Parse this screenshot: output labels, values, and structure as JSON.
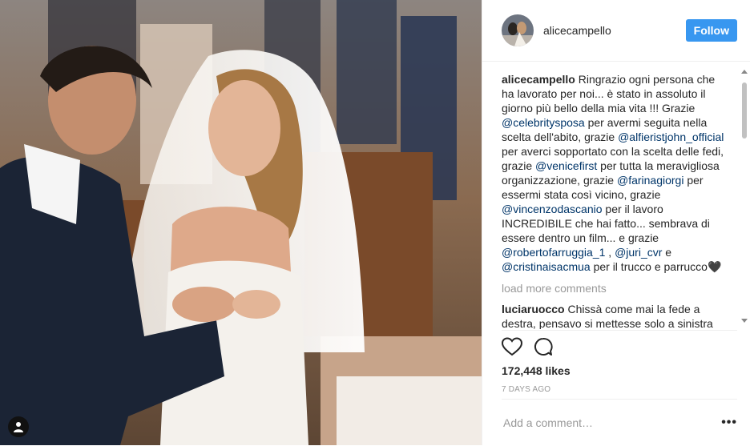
{
  "header": {
    "username": "alicecampello",
    "follow_label": "Follow"
  },
  "caption": {
    "author": "alicecampello",
    "segments": [
      {
        "type": "text",
        "text": " Ringrazio ogni persona che ha lavorato per noi... è stato in assoluto il giorno più bello della mia vita !!! Grazie "
      },
      {
        "type": "mention",
        "text": "@celebritysposa"
      },
      {
        "type": "text",
        "text": " per avermi seguita nella scelta dell'abito, grazie "
      },
      {
        "type": "mention",
        "text": "@alfieristjohn_official"
      },
      {
        "type": "text",
        "text": " per averci sopportato con la scelta delle fedi, grazie "
      },
      {
        "type": "mention",
        "text": "@venicefirst"
      },
      {
        "type": "text",
        "text": " per tutta la meravigliosa organizzazione, grazie "
      },
      {
        "type": "mention",
        "text": "@farinagiorgi"
      },
      {
        "type": "text",
        "text": " per essermi stata così vicino, grazie "
      },
      {
        "type": "mention",
        "text": "@vincenzodascanio"
      },
      {
        "type": "text",
        "text": " per il lavoro INCREDIBILE che hai fatto... sembrava di essere dentro un film... e grazie "
      },
      {
        "type": "mention",
        "text": "@robertofarruggia_1"
      },
      {
        "type": "text",
        "text": " , "
      },
      {
        "type": "mention",
        "text": "@juri_cvr"
      },
      {
        "type": "text",
        "text": " e "
      },
      {
        "type": "mention",
        "text": "@cristinaisacmua"
      },
      {
        "type": "text",
        "text": " per il trucco e parrucco"
      },
      {
        "type": "text",
        "text": "🖤"
      }
    ]
  },
  "load_more_label": "load more comments",
  "comments": [
    {
      "author": "luciaruocco",
      "text": " Chissà come mai la fede a destra, pensavo si mettesse solo a sinistra"
    }
  ],
  "likes": "172,448 likes",
  "time": "7 DAYS AGO",
  "comment_input": {
    "placeholder": "Add a comment…",
    "value": ""
  },
  "icons": {
    "like": "heart-icon",
    "comment": "comment-bubble-icon",
    "more": "more-options-icon",
    "user_tag": "user-tag-icon"
  },
  "colors": {
    "follow_button": "#3897f0",
    "mention": "#003569",
    "muted": "#999999"
  }
}
